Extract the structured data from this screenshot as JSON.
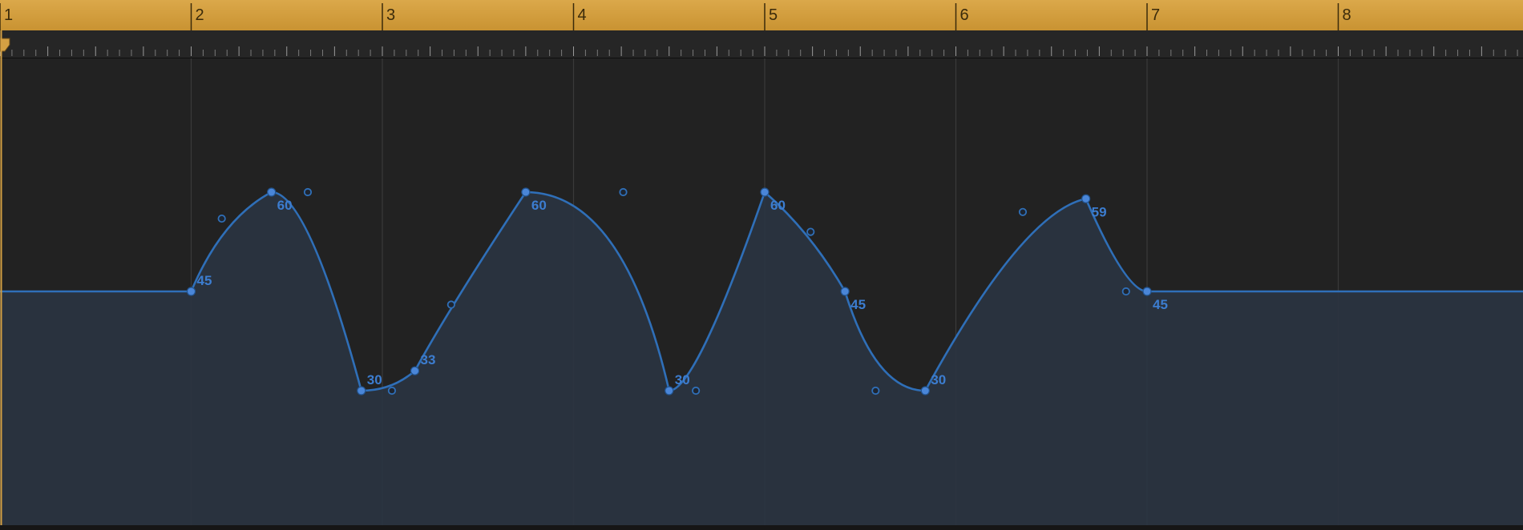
{
  "ruler": {
    "bars": [
      "1",
      "2",
      "3",
      "4",
      "5",
      "6",
      "7",
      "8"
    ],
    "colors": {
      "bar_bg": "#d4a043",
      "bar_text": "#3a2a0a",
      "tick": "#7a7a7a"
    }
  },
  "automation": {
    "line_color": "#2f6fb8",
    "fill_color": "#2a3440",
    "label_color": "#3c7dd0",
    "points": [
      {
        "bar": 1.0,
        "value": 45,
        "label": ""
      },
      {
        "bar": 2.0,
        "value": 45,
        "label": "45"
      },
      {
        "bar": 2.42,
        "value": 60,
        "label": "60"
      },
      {
        "bar": 2.89,
        "value": 30,
        "label": "30"
      },
      {
        "bar": 3.17,
        "value": 33,
        "label": "33"
      },
      {
        "bar": 3.75,
        "value": 60,
        "label": "60"
      },
      {
        "bar": 4.5,
        "value": 30,
        "label": "30"
      },
      {
        "bar": 5.0,
        "value": 60,
        "label": "60"
      },
      {
        "bar": 5.42,
        "value": 45,
        "label": "45"
      },
      {
        "bar": 5.84,
        "value": 30,
        "label": "30"
      },
      {
        "bar": 6.68,
        "value": 59,
        "label": "59"
      },
      {
        "bar": 7.0,
        "value": 45,
        "label": "45"
      },
      {
        "bar": 9.0,
        "value": 45,
        "label": ""
      }
    ],
    "handles": [
      {
        "bar": 2.16,
        "value": 56
      },
      {
        "bar": 2.61,
        "value": 60
      },
      {
        "bar": 3.05,
        "value": 30
      },
      {
        "bar": 3.36,
        "value": 43
      },
      {
        "bar": 4.26,
        "value": 60
      },
      {
        "bar": 4.64,
        "value": 30
      },
      {
        "bar": 5.24,
        "value": 54
      },
      {
        "bar": 5.58,
        "value": 30
      },
      {
        "bar": 6.35,
        "value": 57
      },
      {
        "bar": 6.89,
        "value": 45
      }
    ]
  }
}
